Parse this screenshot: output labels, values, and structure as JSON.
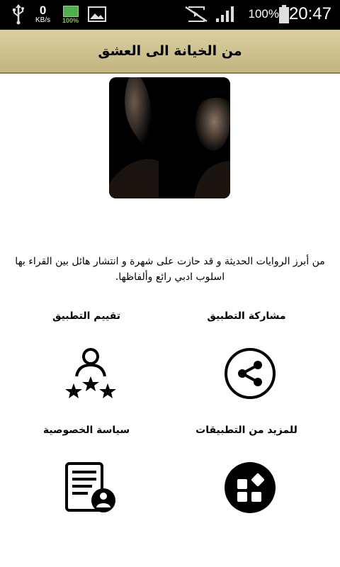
{
  "status_bar": {
    "kbs_value": "0",
    "kbs_unit": "KB/s",
    "battery_small_pct": "100%",
    "battery_pct": "100%",
    "time": "20:47"
  },
  "header": {
    "title": "من الخيانة الى العشق"
  },
  "description": "من أبرز الروايات الحديثة و قد حازت على شهرة و انتشار هائل بين القراء بها اسلوب ادبي رائع وألفاظها.",
  "actions": {
    "share_label": "مشاركة التطبيق",
    "rate_label": "تقييم التطبيق",
    "more_apps_label": "للمزيد من التطبيقات",
    "privacy_label": "سياسة الخصوصية"
  },
  "icons": {
    "usb": "usb-icon",
    "image": "image-icon",
    "mute": "mute-icon",
    "signal": "signal-icon",
    "battery": "battery-icon",
    "share": "share-icon",
    "rate": "rate-stars-icon",
    "more_apps": "apps-grid-icon",
    "privacy": "document-user-icon"
  }
}
